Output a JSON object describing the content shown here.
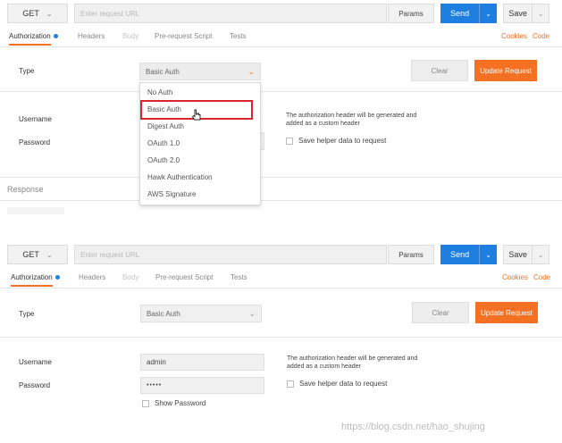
{
  "screen1": {
    "request": {
      "method": "GET",
      "url_placeholder": "Enter request URL",
      "params": "Params",
      "send": "Send",
      "save": "Save"
    },
    "tabs": {
      "authorization": "Authorization",
      "headers": "Headers",
      "body": "Body",
      "pre_request": "Pre-request Script",
      "tests": "Tests"
    },
    "links": {
      "cookies": "Cookies",
      "code": "Code"
    },
    "type_label": "Type",
    "type_value": "Basic Auth",
    "clear": "Clear",
    "update": "Update Request",
    "username_label": "Username",
    "password_label": "Password",
    "note": "The authorization header will be generated and added as a custom header",
    "save_helper": "Save helper data to request",
    "response": "Response",
    "dropdown": [
      "No Auth",
      "Basic Auth",
      "Digest Auth",
      "OAuth 1.0",
      "OAuth 2.0",
      "Hawk Authentication",
      "AWS Signature"
    ]
  },
  "screen2": {
    "request": {
      "method": "GET",
      "url_placeholder": "Enter request URL",
      "params": "Params",
      "send": "Send",
      "save": "Save"
    },
    "tabs": {
      "authorization": "Authorization",
      "headers": "Headers",
      "body": "Body",
      "pre_request": "Pre-request Script",
      "tests": "Tests"
    },
    "links": {
      "cookies": "Cookies",
      "code": "Code"
    },
    "type_label": "Type",
    "type_value": "Basic Auth",
    "clear": "Clear",
    "update": "Update Request",
    "username_label": "Username",
    "username_value": "admin",
    "password_label": "Password",
    "password_value": "•••••",
    "note": "The authorization header will be generated and added as a custom header",
    "save_helper": "Save helper data to request",
    "show_password": "Show Password"
  },
  "watermark": "https://blog.csdn.net/hao_shujing",
  "colors": {
    "accent": "#f47023",
    "send": "#1f7fe0",
    "highlight": "#d9262c"
  }
}
